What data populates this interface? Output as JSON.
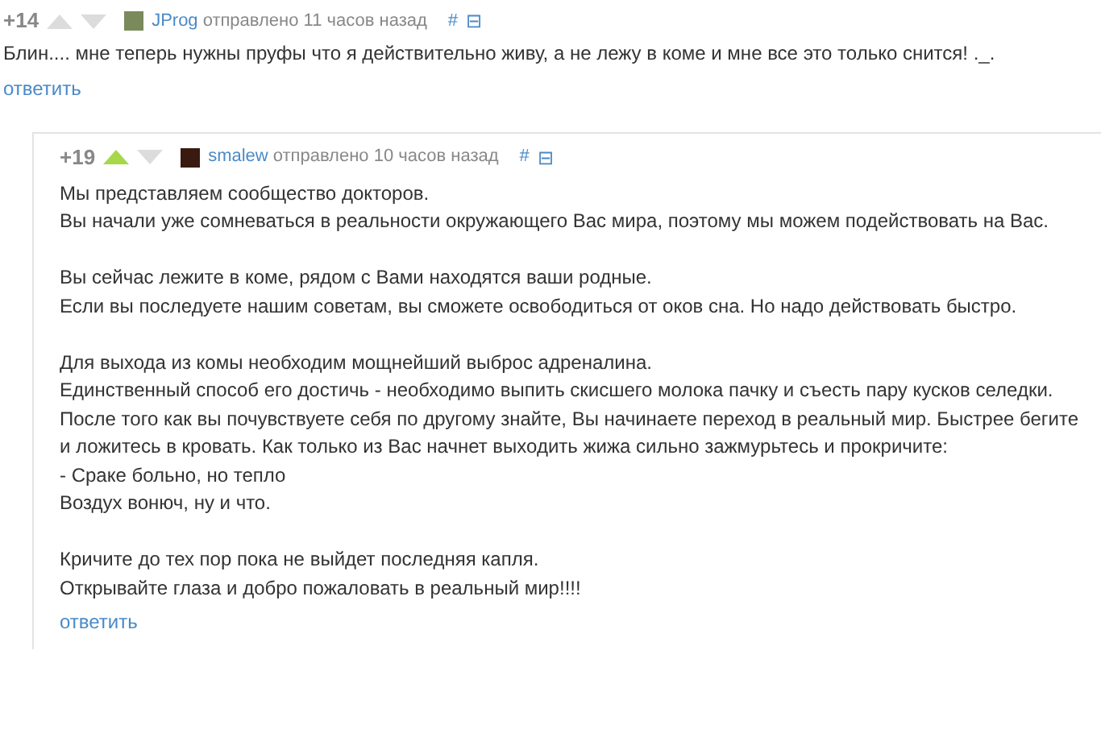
{
  "comments": [
    {
      "score": "+14",
      "upvoted": false,
      "author": "JProg",
      "meta": "отправлено 11 часов назад",
      "permalink": "#",
      "collapse": "⊟",
      "nested": false,
      "paragraphs": [
        [
          "Блин.... мне теперь нужны пруфы что я действительно живу, а не лежу в коме и мне все это только снится! ._."
        ]
      ],
      "reply": "ответить"
    },
    {
      "score": "+19",
      "upvoted": true,
      "author": "smalew",
      "meta": "отправлено 10 часов назад",
      "permalink": "#",
      "collapse": "⊟",
      "nested": true,
      "paragraphs": [
        [
          "Мы представляем сообщество докторов.",
          "Вы начали уже сомневаться в реальности окружающего Вас мира, поэтому мы можем подействовать на Вас."
        ],
        [
          "Вы сейчас лежите в коме, рядом с Вами находятся ваши родные.",
          "Если вы последуете нашим советам, вы сможете освободиться от оков сна. Но надо действовать быстро."
        ],
        [
          "Для выхода из комы необходим мощнейший выброс адреналина.",
          "Единственный способ его достичь - необходимо выпить скисшего молока пачку и съесть пару кусков селедки. После того как вы почувствуете себя по другому знайте, Вы начинаете переход в реальный мир. Быстрее бегите и ложитесь в кровать. Как только из Вас начнет выходить жижа сильно зажмурьтесь и прокричите:",
          "- Сраке больно, но тепло",
          "Воздух вонюч, ну и что."
        ],
        [
          "Кричите до тех пор пока не выйдет последняя капля.",
          "Открывайте глаза и добро пожаловать в реальный мир!!!!"
        ]
      ],
      "reply": "ответить"
    }
  ]
}
